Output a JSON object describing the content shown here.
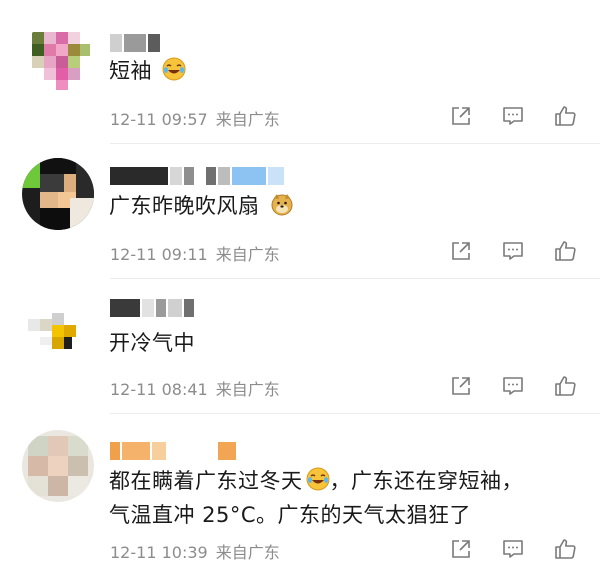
{
  "comments": [
    {
      "text": "短袖",
      "emoji": "laughing-tears-emoji",
      "time": "12-11 09:57",
      "location": "来自广东"
    },
    {
      "text": "广东昨晚吹风扇",
      "emoji": "doge-emoji",
      "time": "12-11 09:11",
      "location": "来自广东"
    },
    {
      "text": "开冷气中",
      "time": "12-11 08:41",
      "location": "来自广东"
    },
    {
      "text_line1": "都在瞒着广东过冬天",
      "emoji": "laughing-tears-emoji",
      "text_line1b": "，广东还在穿短袖，",
      "text_line2": "气温直冲 25°C。广东的天气太猖狂了",
      "time": "12-11 10:39",
      "location": "来自广东"
    }
  ],
  "icons": {
    "share": "share-icon",
    "comment": "comment-icon",
    "like": "thumbs-up-icon"
  },
  "colors": {
    "meta": "#8c8c8c",
    "icon": "#7a7a7a",
    "emoji": "#f6c33a"
  }
}
